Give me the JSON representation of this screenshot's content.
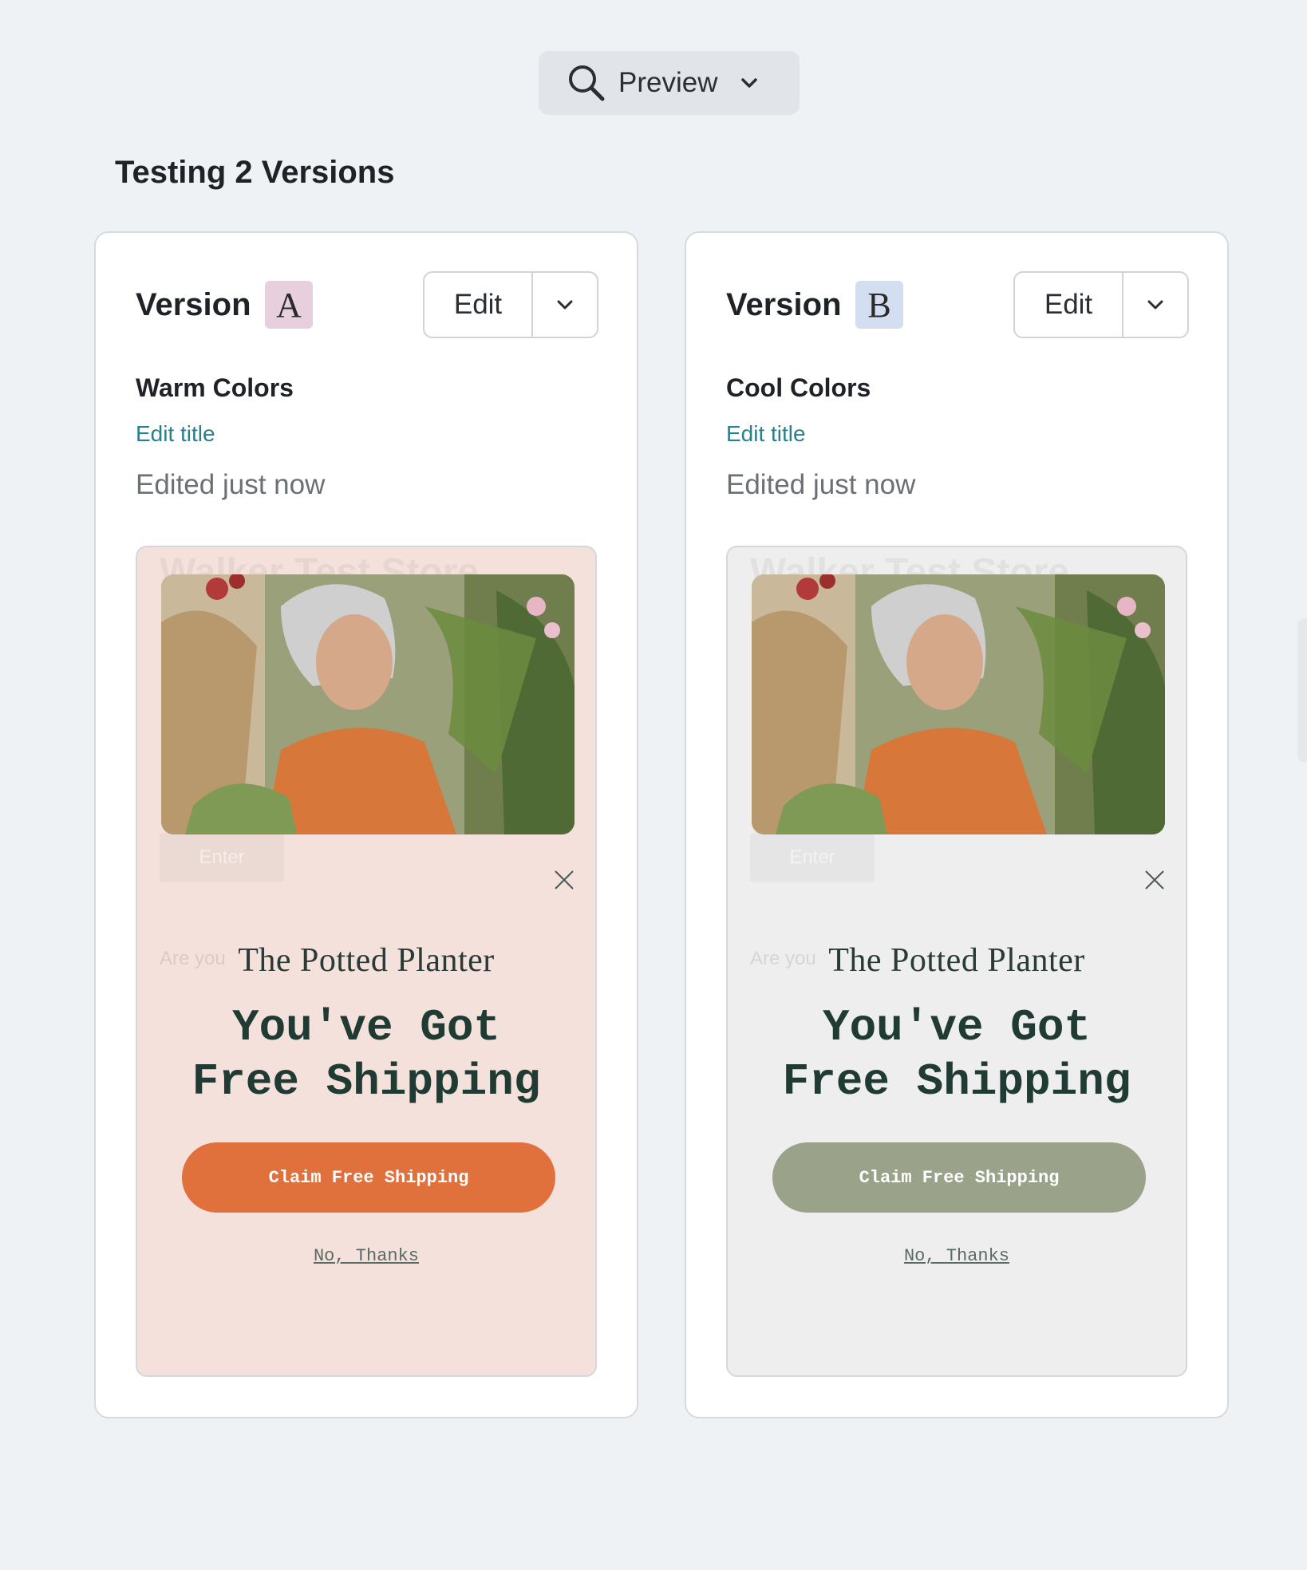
{
  "toolbar": {
    "preview_label": "Preview",
    "preview_icon": "search-icon",
    "dropdown_icon": "chevron-down-icon"
  },
  "page": {
    "heading": "Testing 2 Versions"
  },
  "versions": [
    {
      "label": "Version",
      "letter": "A",
      "badge_color": "#e7cfdd",
      "edit_label": "Edit",
      "title": "Warm Colors",
      "edit_title_label": "Edit title",
      "edited": "Edited just now",
      "preview": {
        "background": "#f4e1db",
        "ghost_store": "Walker Test Store",
        "ghost_enter": "Enter",
        "ghost_are": "Are you",
        "brand": "The Potted Planter",
        "headline_line1": "You've Got",
        "headline_line2": "Free Shipping",
        "cta_label": "Claim Free Shipping",
        "cta_color": "#e0703c",
        "dismiss_label": "No, Thanks"
      }
    },
    {
      "label": "Version",
      "letter": "B",
      "badge_color": "#d4def1",
      "edit_label": "Edit",
      "title": "Cool Colors",
      "edit_title_label": "Edit title",
      "edited": "Edited just now",
      "preview": {
        "background": "#eeeeee",
        "ghost_store": "Walker Test Store",
        "ghost_enter": "Enter",
        "ghost_are": "Are you",
        "brand": "The Potted Planter",
        "headline_line1": "You've Got",
        "headline_line2": "Free Shipping",
        "cta_label": "Claim Free Shipping",
        "cta_color": "#9aa38a",
        "dismiss_label": "No, Thanks"
      }
    }
  ]
}
